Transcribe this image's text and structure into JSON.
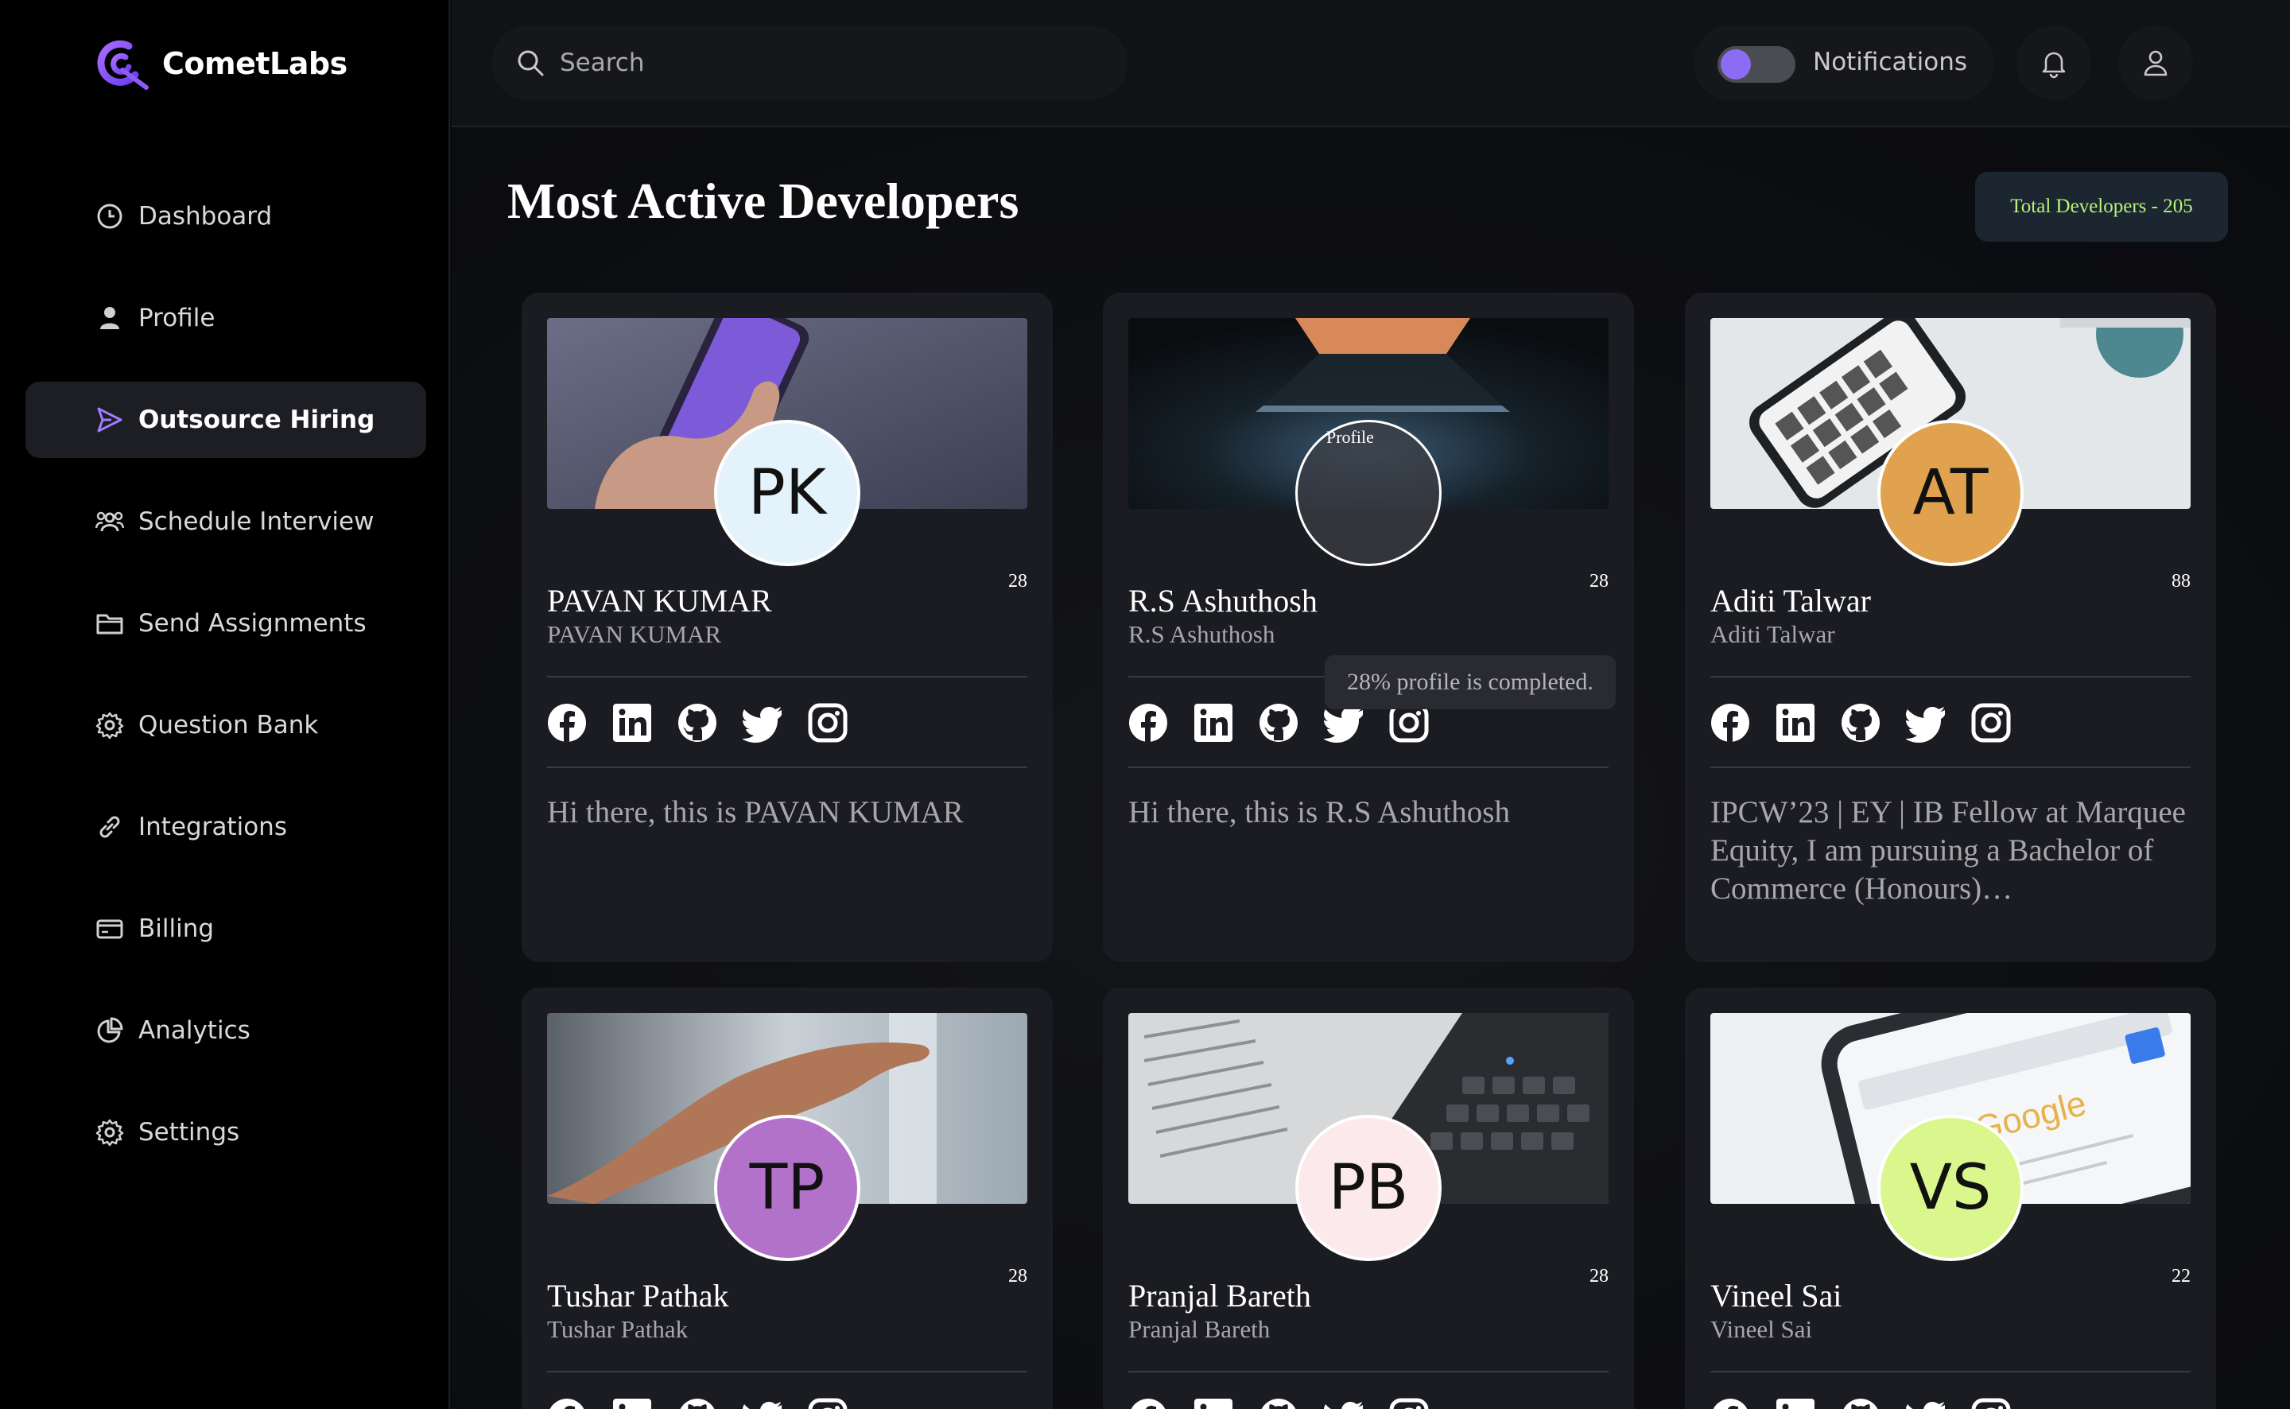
{
  "brand": {
    "name": "CometLabs",
    "accent": "#7b4df0"
  },
  "sidebar": {
    "items": [
      {
        "label": "Dashboard",
        "icon": "clock-icon"
      },
      {
        "label": "Profile",
        "icon": "person-icon"
      },
      {
        "label": "Outsource Hiring",
        "icon": "send-icon",
        "active": true
      },
      {
        "label": "Schedule Interview",
        "icon": "team-icon"
      },
      {
        "label": "Send Assignments",
        "icon": "folder-icon"
      },
      {
        "label": "Question Bank",
        "icon": "gear-icon"
      },
      {
        "label": "Integrations",
        "icon": "link-icon"
      },
      {
        "label": "Billing",
        "icon": "card-icon"
      },
      {
        "label": "Analytics",
        "icon": "pie-chart-icon"
      },
      {
        "label": "Settings",
        "icon": "gear-icon"
      }
    ]
  },
  "topbar": {
    "search_placeholder": "Search",
    "notifications_label": "Notifications"
  },
  "main": {
    "title": "Most Active Developers",
    "total_developers": "Total Developers - 205",
    "tooltip": "28% profile is completed.",
    "broken_avatar_alt": "Profile",
    "developers": [
      {
        "name": "PAVAN KUMAR",
        "sub": "PAVAN KUMAR",
        "initials": "PK",
        "score": "28",
        "bio": "Hi there, this is PAVAN KUMAR",
        "avatar_color": "#e4f3fb"
      },
      {
        "name": "R.S Ashuthosh",
        "sub": "R.S Ashuthosh",
        "initials": "",
        "score": "28",
        "bio": "Hi there, this is R.S Ashuthosh",
        "avatar_color": ""
      },
      {
        "name": "Aditi Talwar",
        "sub": "Aditi Talwar",
        "initials": "AT",
        "score": "88",
        "bio": "IPCW’23 | EY | IB Fellow at Marquee Equity, I am pursuing a Bachelor of Commerce (Honours)…",
        "avatar_color": "#e0a24e"
      },
      {
        "name": "Tushar Pathak",
        "sub": "Tushar Pathak",
        "initials": "TP",
        "score": "28",
        "bio": "",
        "avatar_color": "#b372c9"
      },
      {
        "name": "Pranjal Bareth",
        "sub": "Pranjal Bareth",
        "initials": "PB",
        "score": "28",
        "bio": "",
        "avatar_color": "#fbe9ec"
      },
      {
        "name": "Vineel Sai",
        "sub": "Vineel Sai",
        "initials": "VS",
        "score": "22",
        "bio": "",
        "avatar_color": "#d9f78c"
      }
    ]
  }
}
